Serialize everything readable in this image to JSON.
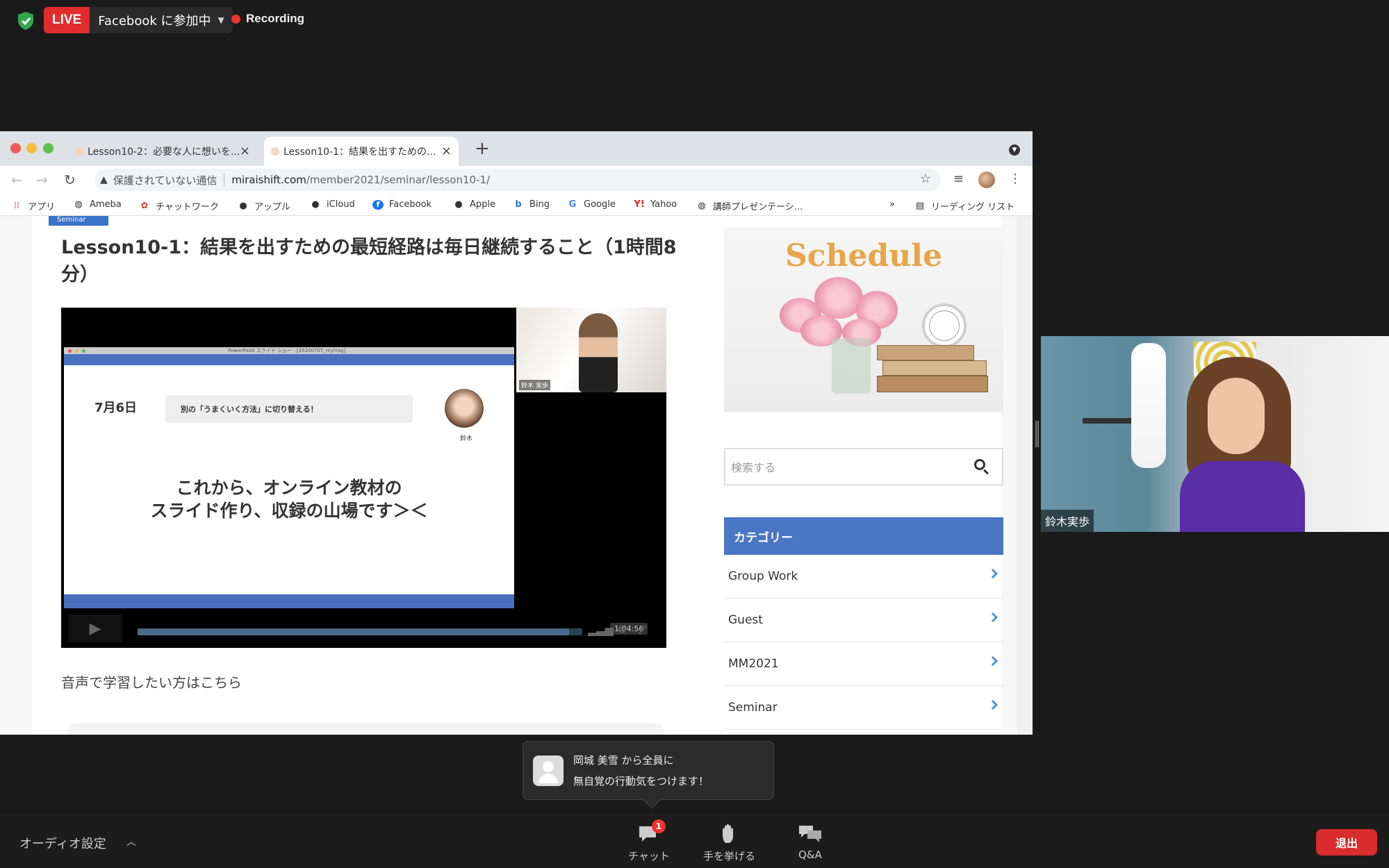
{
  "zoom": {
    "live_badge": "LIVE",
    "live_destination": "Facebook に参加中",
    "recording_label": "Recording"
  },
  "browser": {
    "tabs": [
      {
        "title": "Lesson10-2：必要な人に想いを..."
      },
      {
        "title": "Lesson10-1：結果を出すための..."
      }
    ],
    "omnibox": {
      "security_text": "保護されていない通信",
      "host": "miraishift.com",
      "path": "/member2021/seminar/lesson10-1/"
    },
    "bookmarks": [
      "アプリ",
      "Ameba",
      "チャットワーク",
      "アップル",
      "iCloud",
      "Facebook",
      "Apple",
      "Bing",
      "Google",
      "Yahoo",
      "講師プレゼンテーシ..."
    ],
    "bookmarks_overflow": "»",
    "reading_list": "リーディング リスト"
  },
  "page": {
    "category_tag": "Seminar",
    "article_title": "Lesson10-1：結果を出すための最短経路は毎日継続すること（1時間8分）",
    "video": {
      "slide_window_title": "PowerPoint スライド ショー - [20200707_mymsg]",
      "slide_date": "7月6日",
      "slide_pill": "別の「うまくいく方法」に切り替える！",
      "slide_speaker": "鈴木",
      "slide_main_line1": "これから、オンライン教材の",
      "slide_main_line2": "スライド作り、収録の山場です＞＜",
      "camera_name": "鈴木 実歩",
      "timecode": "1:04:56",
      "progress": 0.97
    },
    "audio_link": "音声で学習したい方はこちら",
    "sidebar": {
      "schedule_title": "Schedule",
      "search_placeholder": "検索する",
      "category_header": "カテゴリー",
      "categories": [
        "Group Work",
        "Guest",
        "MM2021",
        "Seminar"
      ]
    }
  },
  "participant": {
    "name": "鈴木実歩"
  },
  "chat_toast": {
    "line1": "岡城 美雪 から全員に",
    "line2": "無自覚の行動気をつけます！"
  },
  "bottombar": {
    "audio_settings": "オーディオ設定",
    "chat_label": "チャット",
    "chat_badge": "1",
    "raise_hand_label": "手を挙げる",
    "qa_label": "Q&A",
    "leave_label": "退出"
  },
  "colors": {
    "live_red": "#e02c2c",
    "category_blue": "#4a76c3",
    "schedule_orange": "#e8a648",
    "leave_red": "#d92c2c"
  }
}
